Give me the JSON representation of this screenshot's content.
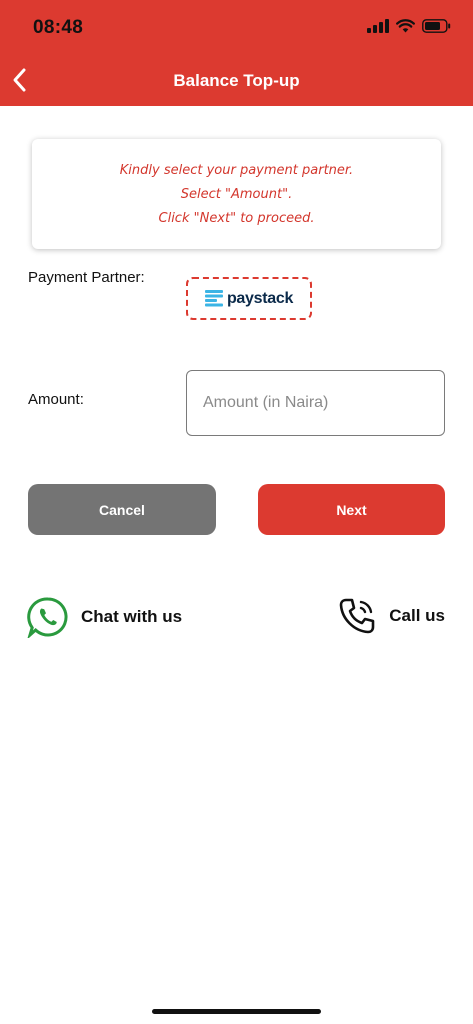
{
  "status_bar": {
    "time": "08:48"
  },
  "header": {
    "title": "Balance Top-up",
    "accent_color": "#dc3a30"
  },
  "info_card": {
    "lines": [
      "Kindly select your payment partner.",
      "Select \"Amount\".",
      "Click \"Next\" to proceed."
    ]
  },
  "payment_partner": {
    "label": "Payment Partner:",
    "selected": "paystack"
  },
  "amount": {
    "label": "Amount:",
    "placeholder": "Amount (in Naira)",
    "value": ""
  },
  "buttons": {
    "cancel": "Cancel",
    "next": "Next"
  },
  "contact": {
    "chat": "Chat with us",
    "call": "Call us"
  },
  "icons": {
    "back": "chevron-left-icon",
    "signal": "cellular-signal-icon",
    "wifi": "wifi-icon",
    "battery": "battery-icon",
    "paystack": "paystack-logo",
    "whatsapp": "whatsapp-icon",
    "phone": "phone-call-icon"
  }
}
